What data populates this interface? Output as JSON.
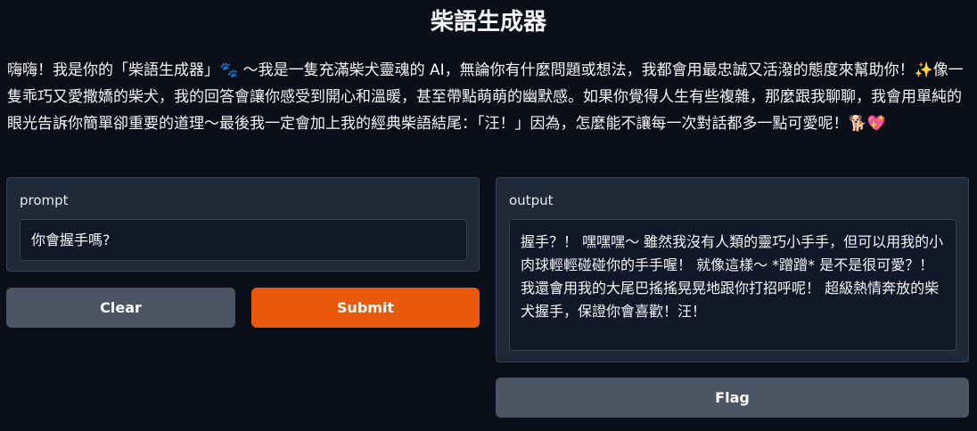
{
  "header": {
    "title": "柴語生成器"
  },
  "description": {
    "text": "嗨嗨！我是你的「柴語生成器」🐾 ～我是一隻充滿柴犬靈魂的 AI，無論你有什麼問題或想法，我都會用最忠誠又活潑的態度來幫助你！✨像一隻乖巧又愛撒嬌的柴犬，我的回答會讓你感受到開心和溫暖，甚至帶點萌萌的幽默感。如果你覺得人生有些複雜，那麼跟我聊聊，我會用單純的眼光告訴你簡單卻重要的道理～最後我一定會加上我的經典柴語結尾：「汪！」因為，怎麼能不讓每一次對話都多一點可愛呢！🐕💖"
  },
  "input_panel": {
    "label": "prompt",
    "value": "你會握手嗎?"
  },
  "output_panel": {
    "label": "output",
    "value": "握手？！ 嘿嘿嘿～ 雖然我沒有人類的靈巧小手手，但可以用我的小肉球輕輕碰碰你的手手喔！ 就像這樣～ *蹭蹭* 是不是很可愛？！ 我還會用我的大尾巴搖搖晃晃地跟你打招呼呢！ 超級熱情奔放的柴犬握手，保證你會喜歡！汪！"
  },
  "buttons": {
    "clear": "Clear",
    "submit": "Submit",
    "flag": "Flag"
  },
  "colors": {
    "background": "#0b0f19",
    "panel": "#1f2937",
    "primary": "#ea580c",
    "secondary": "#4b5563"
  }
}
